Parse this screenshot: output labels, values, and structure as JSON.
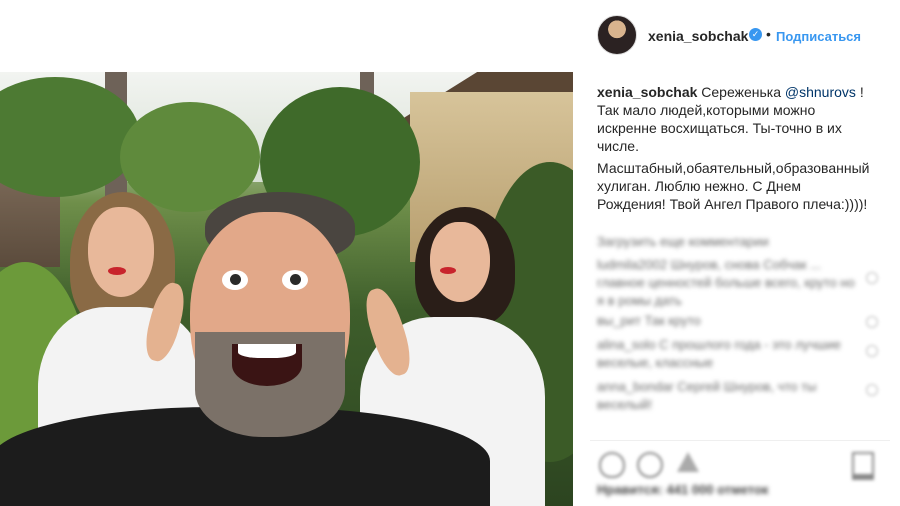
{
  "post": {
    "username": "xenia_sobchak",
    "verified_glyph": "✓",
    "separator": "•",
    "follow_label": "Подписаться",
    "caption": {
      "author": "xenia_sobchak",
      "text_1": "Сереженька",
      "mention": "@shnurovs",
      "text_2": "! Так мало людей,которыми можно искренне восхищаться. Ты-точно в их числе.",
      "text_3": "Масштабный,обаятельный,образованный хулиган. Люблю нежно. С Днем Рождения! Твой Ангел Правого плеча:))))!"
    },
    "load_more_label": "Загрузить еще комментарии",
    "comments": [
      {
        "text": "ludmila2002 Шнуров, снова Собчак ... главное ценностей больше всего, круто но я в ромы дать"
      },
      {
        "text": "вы_рит Так круто"
      },
      {
        "text": "alina_solo С прошлого года - это лучшие веселые, классные"
      },
      {
        "text": "anna_bondar Сергей Шнуров, что ты веселый!"
      }
    ],
    "likes_text": "Нравится: 441 000 отметок"
  },
  "icons": [
    "avatar",
    "verified-icon",
    "heart-icon",
    "comment-icon",
    "share-icon",
    "bookmark-icon"
  ],
  "colors": {
    "link": "#3897f0",
    "text": "#262626",
    "verified": "#3897f0"
  }
}
